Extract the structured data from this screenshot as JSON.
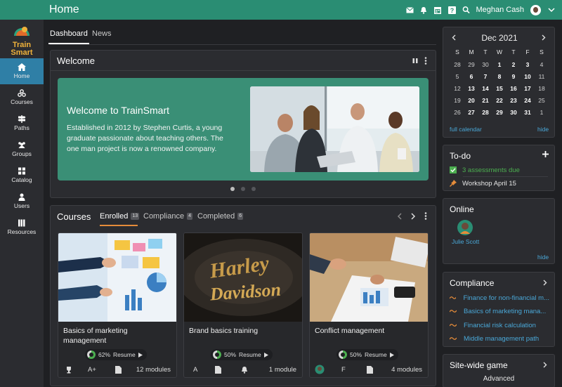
{
  "header": {
    "title": "Home",
    "user_name": "Meghan Cash",
    "icons": [
      "mail-icon",
      "bell-icon",
      "calendar-icon",
      "help-icon",
      "search-icon",
      "chevron-down-icon"
    ]
  },
  "logo": {
    "line1": "Train",
    "line2": "Smart"
  },
  "sidebar": {
    "items": [
      {
        "label": "Home",
        "icon": "home-icon",
        "active": true
      },
      {
        "label": "Courses",
        "icon": "courses-icon"
      },
      {
        "label": "Paths",
        "icon": "signpost-icon"
      },
      {
        "label": "Groups",
        "icon": "groups-icon"
      },
      {
        "label": "Catalog",
        "icon": "grid-icon"
      },
      {
        "label": "Users",
        "icon": "user-icon"
      },
      {
        "label": "Resources",
        "icon": "books-icon"
      }
    ]
  },
  "tabs": [
    {
      "label": "Dashboard",
      "active": true
    },
    {
      "label": "News"
    }
  ],
  "welcome": {
    "panel_title": "Welcome",
    "heading": "Welcome to TrainSmart",
    "text": "Established in 2012 by Stephen Curtis, a young graduate passionate about teaching others. The one man project is now a renowned company."
  },
  "courses": {
    "panel_title": "Courses",
    "tabs": [
      {
        "label": "Enrolled",
        "count": "13",
        "active": true
      },
      {
        "label": "Compliance",
        "count": "4"
      },
      {
        "label": "Completed",
        "count": "6"
      }
    ],
    "items": [
      {
        "title": "Basics of marketing management",
        "progress": 62,
        "progress_label": "62%",
        "resume": "Resume",
        "meta1": "A+",
        "modules": "12 modules"
      },
      {
        "title": "Brand basics training",
        "progress": 50,
        "progress_label": "50%",
        "resume": "Resume",
        "meta1": "A",
        "modules": "1 module"
      },
      {
        "title": "Conflict management",
        "progress": 50,
        "progress_label": "50%",
        "resume": "Resume",
        "meta1": "F",
        "modules": "4 modules"
      }
    ]
  },
  "calendar": {
    "month": "Dec 2021",
    "weekdays": [
      "S",
      "M",
      "T",
      "W",
      "T",
      "F",
      "S"
    ],
    "weeks": [
      [
        "28",
        "29",
        "30",
        "1",
        "2",
        "3",
        "4"
      ],
      [
        "5",
        "6",
        "7",
        "8",
        "9",
        "10",
        "11"
      ],
      [
        "12",
        "13",
        "14",
        "15",
        "16",
        "17",
        "18"
      ],
      [
        "19",
        "20",
        "21",
        "22",
        "23",
        "24",
        "25"
      ],
      [
        "26",
        "27",
        "28",
        "29",
        "30",
        "31",
        "1"
      ]
    ],
    "today": "9",
    "full_calendar": "full calendar",
    "hide": "hide"
  },
  "todo": {
    "title": "To-do",
    "items": [
      {
        "text": "3 assessments due",
        "icon": "check-square-icon",
        "color": "#4caf50"
      },
      {
        "text": "Workshop April 15",
        "icon": "pin-icon",
        "color": "#e58c3a"
      }
    ]
  },
  "online": {
    "title": "Online",
    "user": "Julie Scott",
    "hide": "hide"
  },
  "compliance": {
    "title": "Compliance",
    "items": [
      "Finance for non-financial m...",
      "Basics of marketing mana...",
      "Financial risk calculation",
      "Middle management path"
    ]
  },
  "game": {
    "title": "Site-wide game",
    "level": "Advanced"
  },
  "colors": {
    "header": "#2a8d73",
    "accent": "#e58c3a",
    "link": "#4aa8d8",
    "nav_active": "#2f7fa6"
  }
}
